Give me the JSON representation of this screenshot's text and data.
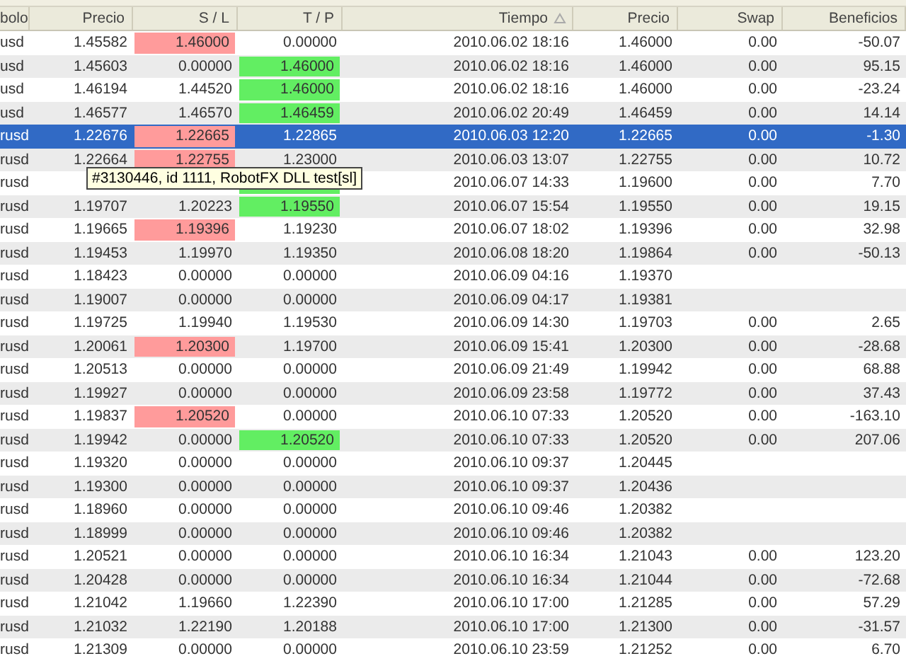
{
  "columns": [
    {
      "label": "bolo"
    },
    {
      "label": "Precio"
    },
    {
      "label": "S / L"
    },
    {
      "label": "T / P"
    },
    {
      "label": "Tiempo",
      "sorted": true
    },
    {
      "label": "Precio"
    },
    {
      "label": "Swap"
    },
    {
      "label": "Beneficios"
    }
  ],
  "rows": [
    {
      "selected": false,
      "symbol": "usd",
      "price": "1.45582",
      "sl": {
        "text": "1.46000",
        "hit": true
      },
      "tp": {
        "text": "0.00000",
        "hit": false
      },
      "time": "2010.06.02 18:16",
      "close": "1.46000",
      "swap": "0.00",
      "profit": "-50.07"
    },
    {
      "selected": false,
      "symbol": "usd",
      "price": "1.45603",
      "sl": {
        "text": "0.00000",
        "hit": false
      },
      "tp": {
        "text": "1.46000",
        "hit": true
      },
      "time": "2010.06.02 18:16",
      "close": "1.46000",
      "swap": "0.00",
      "profit": "95.15"
    },
    {
      "selected": false,
      "symbol": "usd",
      "price": "1.46194",
      "sl": {
        "text": "1.44520",
        "hit": false
      },
      "tp": {
        "text": "1.46000",
        "hit": true
      },
      "time": "2010.06.02 18:16",
      "close": "1.46000",
      "swap": "0.00",
      "profit": "-23.24"
    },
    {
      "selected": false,
      "symbol": "usd",
      "price": "1.46577",
      "sl": {
        "text": "1.46570",
        "hit": false
      },
      "tp": {
        "text": "1.46459",
        "hit": true
      },
      "time": "2010.06.02 20:49",
      "close": "1.46459",
      "swap": "0.00",
      "profit": "14.14"
    },
    {
      "selected": true,
      "symbol": "rusd",
      "price": "1.22676",
      "sl": {
        "text": "1.22665",
        "hit": true
      },
      "tp": {
        "text": "1.22865",
        "hit": false
      },
      "time": "2010.06.03 12:20",
      "close": "1.22665",
      "swap": "0.00",
      "profit": "-1.30"
    },
    {
      "selected": false,
      "symbol": "rusd",
      "price": "1.22664",
      "sl": {
        "text": "1.22755",
        "hit": true
      },
      "tp": {
        "text": "1.23000",
        "hit": false
      },
      "time": "2010.06.03 13:07",
      "close": "1.22755",
      "swap": "0.00",
      "profit": "10.72"
    },
    {
      "selected": false,
      "symbol": "rusd",
      "tp": {
        "hit": true
      },
      "time": "2010.06.07 14:33",
      "close": "1.19600",
      "swap": "0.00",
      "profit": "7.70"
    },
    {
      "selected": false,
      "symbol": "rusd",
      "price": "1.19707",
      "sl": {
        "text": "1.20223",
        "hit": false
      },
      "tp": {
        "text": "1.19550",
        "hit": true
      },
      "time": "2010.06.07 15:54",
      "close": "1.19550",
      "swap": "0.00",
      "profit": "19.15"
    },
    {
      "selected": false,
      "symbol": "rusd",
      "price": "1.19665",
      "sl": {
        "text": "1.19396",
        "hit": true
      },
      "tp": {
        "text": "1.19230",
        "hit": false
      },
      "time": "2010.06.07 18:02",
      "close": "1.19396",
      "swap": "0.00",
      "profit": "32.98"
    },
    {
      "selected": false,
      "symbol": "rusd",
      "price": "1.19453",
      "sl": {
        "text": "1.19970",
        "hit": false
      },
      "tp": {
        "text": "1.19350",
        "hit": false
      },
      "time": "2010.06.08 18:20",
      "close": "1.19864",
      "swap": "0.00",
      "profit": "-50.13"
    },
    {
      "selected": false,
      "symbol": "rusd",
      "price": "1.18423",
      "sl": {
        "text": "0.00000",
        "hit": false
      },
      "tp": {
        "text": "0.00000",
        "hit": false
      },
      "time": "2010.06.09 04:16",
      "close": "1.19370"
    },
    {
      "selected": false,
      "symbol": "rusd",
      "price": "1.19007",
      "sl": {
        "text": "0.00000",
        "hit": false
      },
      "tp": {
        "text": "0.00000",
        "hit": false
      },
      "time": "2010.06.09 04:17",
      "close": "1.19381"
    },
    {
      "selected": false,
      "symbol": "rusd",
      "price": "1.19725",
      "sl": {
        "text": "1.19940",
        "hit": false
      },
      "tp": {
        "text": "1.19530",
        "hit": false
      },
      "time": "2010.06.09 14:30",
      "close": "1.19703",
      "swap": "0.00",
      "profit": "2.65"
    },
    {
      "selected": false,
      "symbol": "rusd",
      "price": "1.20061",
      "sl": {
        "text": "1.20300",
        "hit": true
      },
      "tp": {
        "text": "1.19700",
        "hit": false
      },
      "time": "2010.06.09 15:41",
      "close": "1.20300",
      "swap": "0.00",
      "profit": "-28.68"
    },
    {
      "selected": false,
      "symbol": "rusd",
      "price": "1.20513",
      "sl": {
        "text": "0.00000",
        "hit": false
      },
      "tp": {
        "text": "0.00000",
        "hit": false
      },
      "time": "2010.06.09 21:49",
      "close": "1.19942",
      "swap": "0.00",
      "profit": "68.88"
    },
    {
      "selected": false,
      "symbol": "rusd",
      "price": "1.19927",
      "sl": {
        "text": "0.00000",
        "hit": false
      },
      "tp": {
        "text": "0.00000",
        "hit": false
      },
      "time": "2010.06.09 23:58",
      "close": "1.19772",
      "swap": "0.00",
      "profit": "37.43"
    },
    {
      "selected": false,
      "symbol": "rusd",
      "price": "1.19837",
      "sl": {
        "text": "1.20520",
        "hit": true
      },
      "tp": {
        "text": "0.00000",
        "hit": false
      },
      "time": "2010.06.10 07:33",
      "close": "1.20520",
      "swap": "0.00",
      "profit": "-163.10"
    },
    {
      "selected": false,
      "symbol": "rusd",
      "price": "1.19942",
      "sl": {
        "text": "0.00000",
        "hit": false
      },
      "tp": {
        "text": "1.20520",
        "hit": true
      },
      "time": "2010.06.10 07:33",
      "close": "1.20520",
      "swap": "0.00",
      "profit": "207.06"
    },
    {
      "selected": false,
      "symbol": "rusd",
      "price": "1.19320",
      "sl": {
        "text": "0.00000",
        "hit": false
      },
      "tp": {
        "text": "0.00000",
        "hit": false
      },
      "time": "2010.06.10 09:37",
      "close": "1.20445"
    },
    {
      "selected": false,
      "symbol": "rusd",
      "price": "1.19300",
      "sl": {
        "text": "0.00000",
        "hit": false
      },
      "tp": {
        "text": "0.00000",
        "hit": false
      },
      "time": "2010.06.10 09:37",
      "close": "1.20436"
    },
    {
      "selected": false,
      "symbol": "rusd",
      "price": "1.18960",
      "sl": {
        "text": "0.00000",
        "hit": false
      },
      "tp": {
        "text": "0.00000",
        "hit": false
      },
      "time": "2010.06.10 09:46",
      "close": "1.20382"
    },
    {
      "selected": false,
      "symbol": "rusd",
      "price": "1.18999",
      "sl": {
        "text": "0.00000",
        "hit": false
      },
      "tp": {
        "text": "0.00000",
        "hit": false
      },
      "time": "2010.06.10 09:46",
      "close": "1.20382"
    },
    {
      "selected": false,
      "symbol": "rusd",
      "price": "1.20521",
      "sl": {
        "text": "0.00000",
        "hit": false
      },
      "tp": {
        "text": "0.00000",
        "hit": false
      },
      "time": "2010.06.10 16:34",
      "close": "1.21043",
      "swap": "0.00",
      "profit": "123.20"
    },
    {
      "selected": false,
      "symbol": "rusd",
      "price": "1.20428",
      "sl": {
        "text": "0.00000",
        "hit": false
      },
      "tp": {
        "text": "0.00000",
        "hit": false
      },
      "time": "2010.06.10 16:34",
      "close": "1.21044",
      "swap": "0.00",
      "profit": "-72.68"
    },
    {
      "selected": false,
      "symbol": "rusd",
      "price": "1.21042",
      "sl": {
        "text": "1.19660",
        "hit": false
      },
      "tp": {
        "text": "1.22390",
        "hit": false
      },
      "time": "2010.06.10 17:00",
      "close": "1.21285",
      "swap": "0.00",
      "profit": "57.29"
    },
    {
      "selected": false,
      "symbol": "rusd",
      "price": "1.21032",
      "sl": {
        "text": "1.22190",
        "hit": false
      },
      "tp": {
        "text": "1.20188",
        "hit": false
      },
      "time": "2010.06.10 17:00",
      "close": "1.21300",
      "swap": "0.00",
      "profit": "-31.57"
    },
    {
      "selected": false,
      "symbol": "rusd",
      "price": "1.21309",
      "sl": {
        "text": "0.00000",
        "hit": false
      },
      "tp": {
        "text": "0.00000",
        "hit": false
      },
      "time": "2010.06.10 23:59",
      "close": "1.21252",
      "swap": "0.00",
      "profit": "6.70"
    }
  ],
  "tooltip": {
    "text": "#3130446, id 1111, RobotFX DLL test[sl]"
  }
}
